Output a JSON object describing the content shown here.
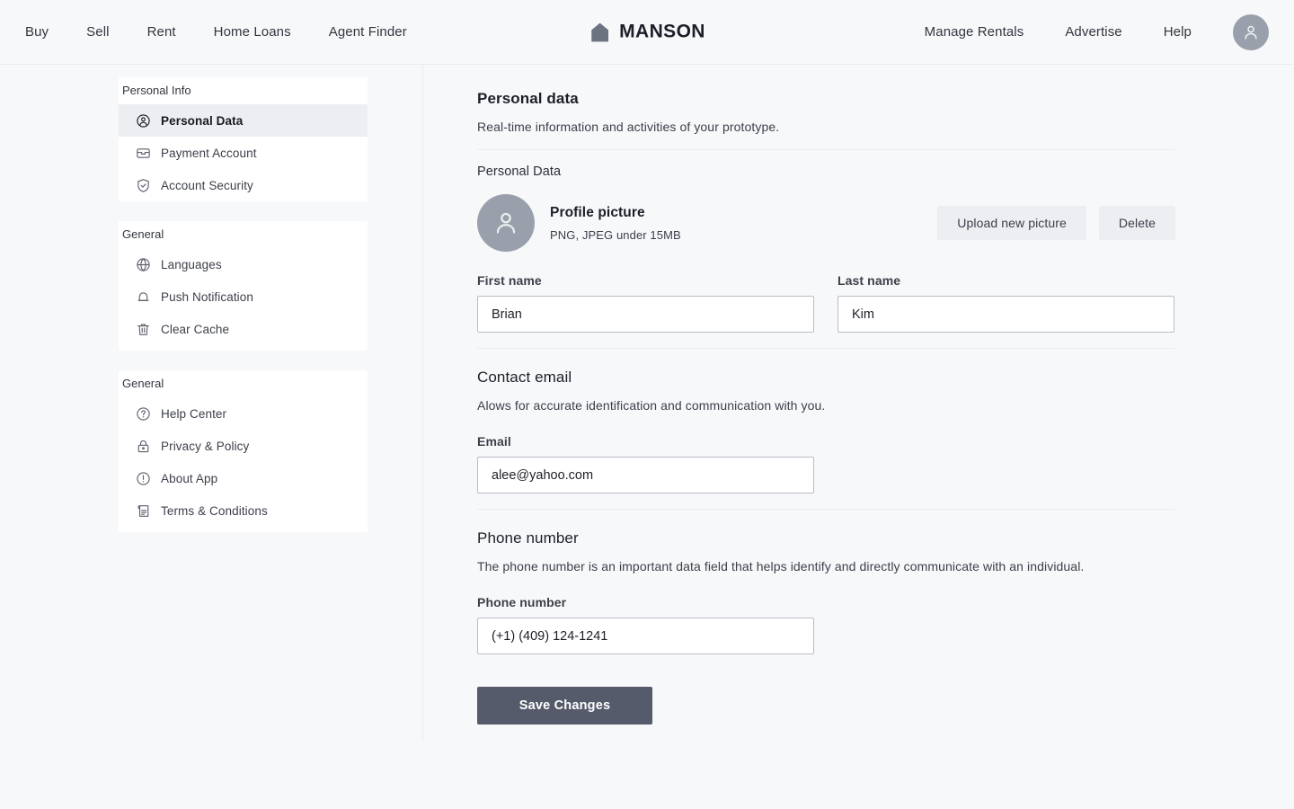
{
  "header": {
    "nav_left": [
      {
        "label": "Buy",
        "name": "nav-buy"
      },
      {
        "label": "Sell",
        "name": "nav-sell"
      },
      {
        "label": "Rent",
        "name": "nav-rent"
      },
      {
        "label": "Home Loans",
        "name": "nav-home-loans"
      },
      {
        "label": "Agent Finder",
        "name": "nav-agent-finder"
      }
    ],
    "brand": {
      "name": "MANSON",
      "icon": "house-icon"
    },
    "nav_right": [
      {
        "label": "Manage Rentals",
        "name": "nav-manage-rentals"
      },
      {
        "label": "Advertise",
        "name": "nav-advertise"
      },
      {
        "label": "Help",
        "name": "nav-help"
      }
    ],
    "avatar_icon": "user-avatar-icon"
  },
  "sidebar": {
    "groups": [
      {
        "title": "Personal Info",
        "items": [
          {
            "label": "Personal Data",
            "icon": "user-circle-icon",
            "active": true
          },
          {
            "label": "Payment Account",
            "icon": "card-icon",
            "active": false
          },
          {
            "label": "Account Security",
            "icon": "shield-check-icon",
            "active": false
          }
        ]
      },
      {
        "title": "General",
        "items": [
          {
            "label": "Languages",
            "icon": "globe-icon",
            "active": false
          },
          {
            "label": "Push Notification",
            "icon": "bell-icon",
            "active": false
          },
          {
            "label": "Clear Cache",
            "icon": "trash-icon",
            "active": false
          }
        ]
      },
      {
        "title": "General",
        "items": [
          {
            "label": "Help Center",
            "icon": "question-circle-icon",
            "active": false
          },
          {
            "label": "Privacy & Policy",
            "icon": "lock-icon",
            "active": false
          },
          {
            "label": "About App",
            "icon": "info-circle-icon",
            "active": false
          },
          {
            "label": "Terms & Conditions",
            "icon": "document-list-icon",
            "active": false
          }
        ]
      }
    ]
  },
  "main": {
    "page_title": "Personal data",
    "page_subtitle": "Real-time information and activities of your prototype.",
    "personal_data_label": "Personal Data",
    "profile": {
      "title": "Profile picture",
      "hint": "PNG,  JPEG under 15MB",
      "avatar_icon": "user-avatar-icon",
      "upload_label": "Upload new picture",
      "delete_label": "Delete"
    },
    "first_name": {
      "label": "First name",
      "value": "Brian",
      "placeholder": "First name"
    },
    "last_name": {
      "label": "Last name",
      "value": "Kim",
      "placeholder": "Last name"
    },
    "contact_email": {
      "heading": "Contact email",
      "description": "Alows for accurate identification and communication with you.",
      "label": "Email",
      "value": "alee@yahoo.com",
      "placeholder": "Email"
    },
    "phone": {
      "heading": "Phone number",
      "description": "The phone number is an important data field that helps identify and directly communicate with an individual.",
      "label": "Phone number",
      "value": "(+1) (409) 124-1241",
      "placeholder": "Phone number"
    },
    "save_label": "Save Changes"
  },
  "colors": {
    "page_bg": "#f7f8fa",
    "card_bg": "#ffffff",
    "active_item_bg": "#eceef1",
    "soft_button_bg": "#eceef1",
    "primary_button_bg": "#555b6b",
    "avatar_bg": "#9aa0ab",
    "border": "#e8eaee",
    "input_border": "#b9bdc5",
    "text": "#1d1f28"
  }
}
